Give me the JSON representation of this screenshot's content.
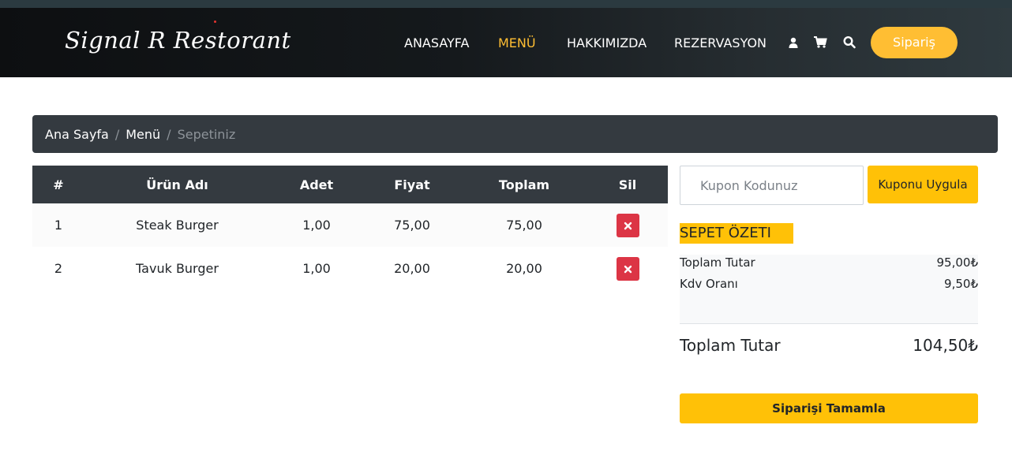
{
  "navbar": {
    "brand": "Signal R Restorant",
    "links": [
      {
        "label": "ANASAYFA",
        "active": false
      },
      {
        "label": "MENÜ",
        "active": true
      },
      {
        "label": "HAKKIMIZDA",
        "active": false
      },
      {
        "label": "REZERVASYON",
        "active": false
      }
    ],
    "icons": [
      "user-icon",
      "cart-icon",
      "search-icon"
    ],
    "order_button": "Sipariş",
    "accent_color": "#ffbe33"
  },
  "breadcrumb": {
    "items": [
      "Ana Sayfa",
      "Menü"
    ],
    "current": "Sepetiniz"
  },
  "cart": {
    "headers": [
      "#",
      "Ürün Adı",
      "Adet",
      "Fiyat",
      "Toplam",
      "Sil"
    ],
    "rows": [
      {
        "no": "1",
        "name": "Steak Burger",
        "qty": "1,00",
        "price": "75,00",
        "total": "75,00"
      },
      {
        "no": "2",
        "name": "Tavuk Burger",
        "qty": "1,00",
        "price": "20,00",
        "total": "20,00"
      }
    ],
    "delete_icon": "close-icon",
    "delete_color": "#dc3545"
  },
  "coupon": {
    "placeholder": "Kupon Kodunuz",
    "button": "Kuponu Uygula"
  },
  "summary": {
    "title": "SEPET ÖZETI",
    "subtotal_label": "Toplam Tutar",
    "subtotal_value": "95,00₺",
    "tax_label": "Kdv Oranı",
    "tax_value": "9,50₺",
    "total_label": "Toplam Tutar",
    "total_value": "104,50₺",
    "complete_button": "Siparişi Tamamla",
    "button_color": "#ffc107"
  }
}
